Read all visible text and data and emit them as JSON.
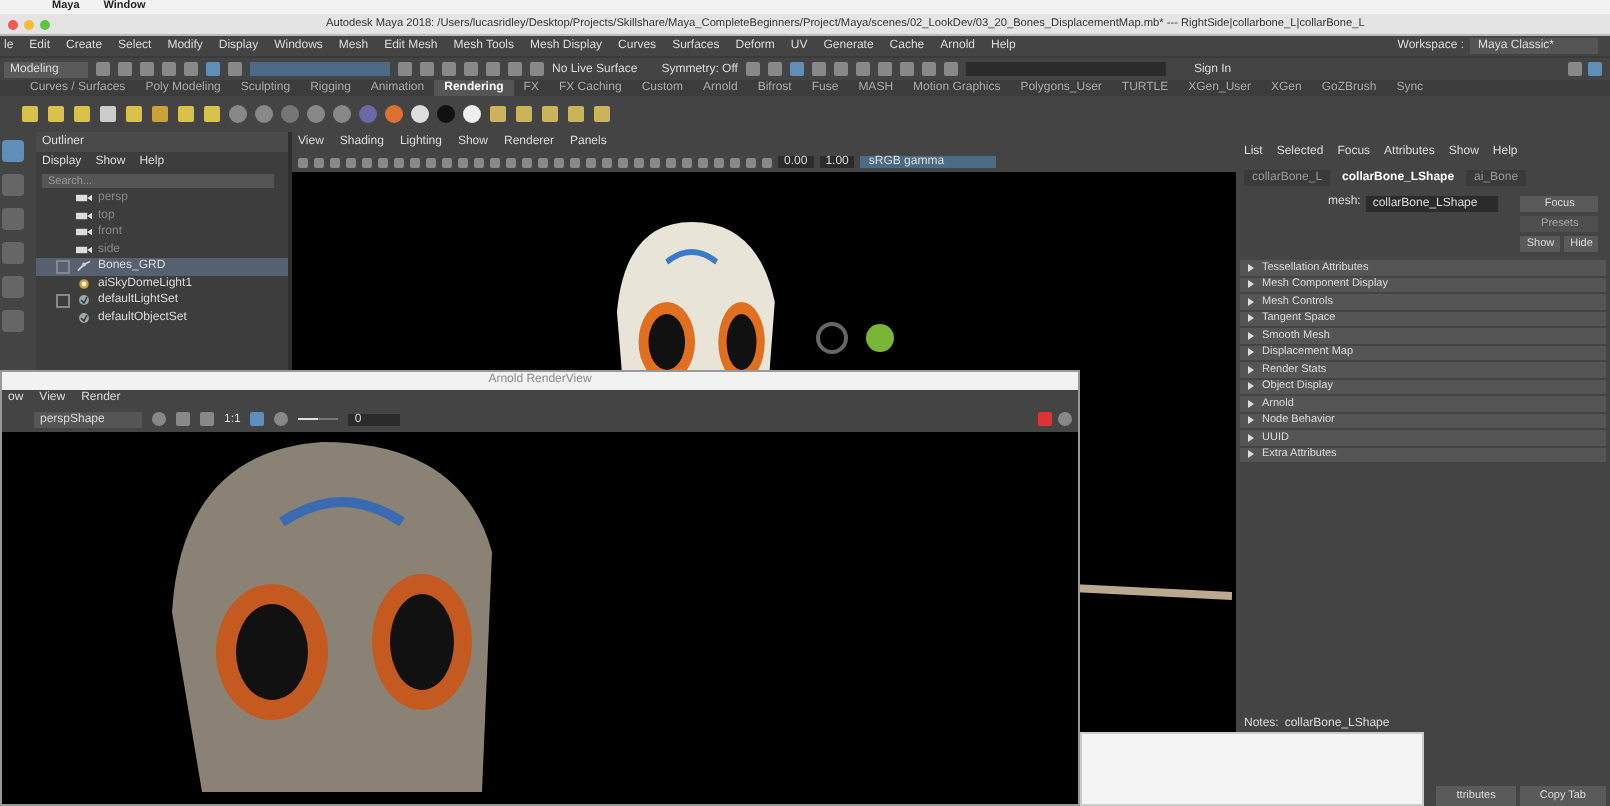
{
  "mac_menu": [
    "Maya",
    "Window"
  ],
  "title": "Autodesk Maya 2018: /Users/lucasridley/Desktop/Projects/Skillshare/Maya_CompleteBeginners/Project/Maya/scenes/02_LookDev/03_20_Bones_DisplacementMap.mb*  ---  RightSide|collarbone_L|collarBone_L",
  "menus": [
    "le",
    "Edit",
    "Create",
    "Select",
    "Modify",
    "Display",
    "Windows",
    "Mesh",
    "Edit Mesh",
    "Mesh Tools",
    "Mesh Display",
    "Curves",
    "Surfaces",
    "Deform",
    "UV",
    "Generate",
    "Cache",
    "Arnold",
    "Help"
  ],
  "workspace": {
    "label": "Workspace :",
    "value": "Maya Classic*"
  },
  "status_line": {
    "mode": "Modeling",
    "live_surface": "No Live Surface",
    "symmetry": "Symmetry: Off",
    "sign_in": "Sign In"
  },
  "shelf_tabs": [
    {
      "label": "Curves / Surfaces",
      "selected": false
    },
    {
      "label": "Poly Modeling",
      "selected": false
    },
    {
      "label": "Sculpting",
      "selected": false
    },
    {
      "label": "Rigging",
      "selected": false
    },
    {
      "label": "Animation",
      "selected": false
    },
    {
      "label": "Rendering",
      "selected": true
    },
    {
      "label": "FX",
      "selected": false
    },
    {
      "label": "FX Caching",
      "selected": false
    },
    {
      "label": "Custom",
      "selected": false
    },
    {
      "label": "Arnold",
      "selected": false
    },
    {
      "label": "Bifrost",
      "selected": false
    },
    {
      "label": "Fuse",
      "selected": false
    },
    {
      "label": "MASH",
      "selected": false
    },
    {
      "label": "Motion Graphics",
      "selected": false
    },
    {
      "label": "Polygons_User",
      "selected": false
    },
    {
      "label": "TURTLE",
      "selected": false
    },
    {
      "label": "XGen_User",
      "selected": false
    },
    {
      "label": "XGen",
      "selected": false
    },
    {
      "label": "GoZBrush",
      "selected": false
    },
    {
      "label": "Sync",
      "selected": false
    }
  ],
  "outliner": {
    "title": "Outliner",
    "menus": [
      "Display",
      "Show",
      "Help"
    ],
    "placeholder": "Search...",
    "items": [
      {
        "label": "persp",
        "kind": "camera",
        "selected": false
      },
      {
        "label": "top",
        "kind": "camera",
        "selected": false
      },
      {
        "label": "front",
        "kind": "camera",
        "selected": false
      },
      {
        "label": "side",
        "kind": "camera",
        "selected": false
      },
      {
        "label": "Bones_GRD",
        "kind": "group",
        "selected": true,
        "expanded": false
      },
      {
        "label": "aiSkyDomeLight1",
        "kind": "light",
        "selected": false
      },
      {
        "label": "defaultLightSet",
        "kind": "set",
        "selected": false,
        "expanded": false
      },
      {
        "label": "defaultObjectSet",
        "kind": "set",
        "selected": false
      }
    ]
  },
  "viewport": {
    "menus": [
      "View",
      "Shading",
      "Lighting",
      "Show",
      "Renderer",
      "Panels"
    ],
    "exposure": "0.00",
    "gamma": "1.00",
    "color_space": "sRGB gamma"
  },
  "attribute_editor": {
    "menus": [
      "List",
      "Selected",
      "Focus",
      "Attributes",
      "Show",
      "Help"
    ],
    "tabs": [
      {
        "label": "collarBone_L",
        "selected": false
      },
      {
        "label": "collarBone_LShape",
        "selected": true
      },
      {
        "label": "ai_Bone",
        "selected": false
      }
    ],
    "mesh_label": "mesh:",
    "mesh_value": "collarBone_LShape",
    "buttons": [
      {
        "label": "Focus",
        "disabled": false
      },
      {
        "label": "Presets",
        "disabled": true
      },
      {
        "label": "Show",
        "disabled": false
      },
      {
        "label": "Hide",
        "disabled": false
      }
    ],
    "sections": [
      "Tessellation Attributes",
      "Mesh Component Display",
      "Mesh Controls",
      "Tangent Space",
      "Smooth Mesh",
      "Displacement Map",
      "Render Stats",
      "Object Display",
      "Arnold",
      "Node Behavior",
      "UUID",
      "Extra Attributes"
    ],
    "notes_label": "Notes:",
    "notes_value": "collarBone_LShape",
    "bottom_buttons": [
      "ttributes",
      "Copy Tab"
    ]
  },
  "render_view": {
    "title": "Arnold RenderView",
    "menus": [
      "ow",
      "View",
      "Render"
    ],
    "camera": "perspShape",
    "ratio": "1:1",
    "exposure": "0",
    "exposure_slider": {
      "level": 0.5
    }
  }
}
